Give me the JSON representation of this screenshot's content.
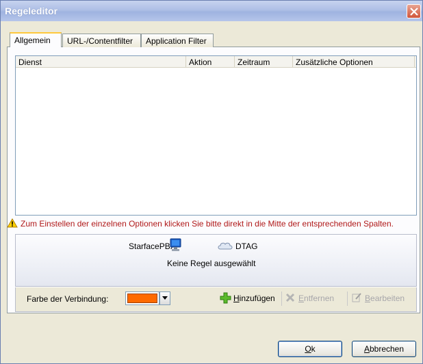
{
  "window": {
    "title": "Regeleditor"
  },
  "tabs": [
    {
      "label": "Allgemein",
      "active": true
    },
    {
      "label": "URL-/Contentfilter",
      "active": false
    },
    {
      "label": "Application Filter",
      "active": false
    }
  ],
  "table": {
    "columns": [
      "Dienst",
      "Aktion",
      "Zeitraum",
      "Zusätzliche Optionen"
    ],
    "rows": []
  },
  "hint": {
    "icon": "warning-icon",
    "text": "Zum Einstellen der einzelnen Optionen klicken Sie bitte direkt in die Mitte der entsprechenden Spalten.",
    "color": "#b01818"
  },
  "connection": {
    "source": "StarfacePBX",
    "source_icon": "computer-icon",
    "destination": "DTAG",
    "destination_icon": "cloud-icon",
    "status": "Keine Regel ausgewählt"
  },
  "toolbar": {
    "color_label": "Farbe der Verbindung:",
    "color_value": "#ff6a00",
    "add_label_rest": "inzufügen",
    "add_mnemonic": "H",
    "remove_label_rest": "ntfernen",
    "remove_mnemonic": "E",
    "edit_label_rest": "earbeiten",
    "edit_mnemonic": "B"
  },
  "buttons": {
    "ok_mnemonic": "O",
    "ok_rest": "k",
    "cancel_mnemonic": "A",
    "cancel_rest": "bbrechen"
  }
}
